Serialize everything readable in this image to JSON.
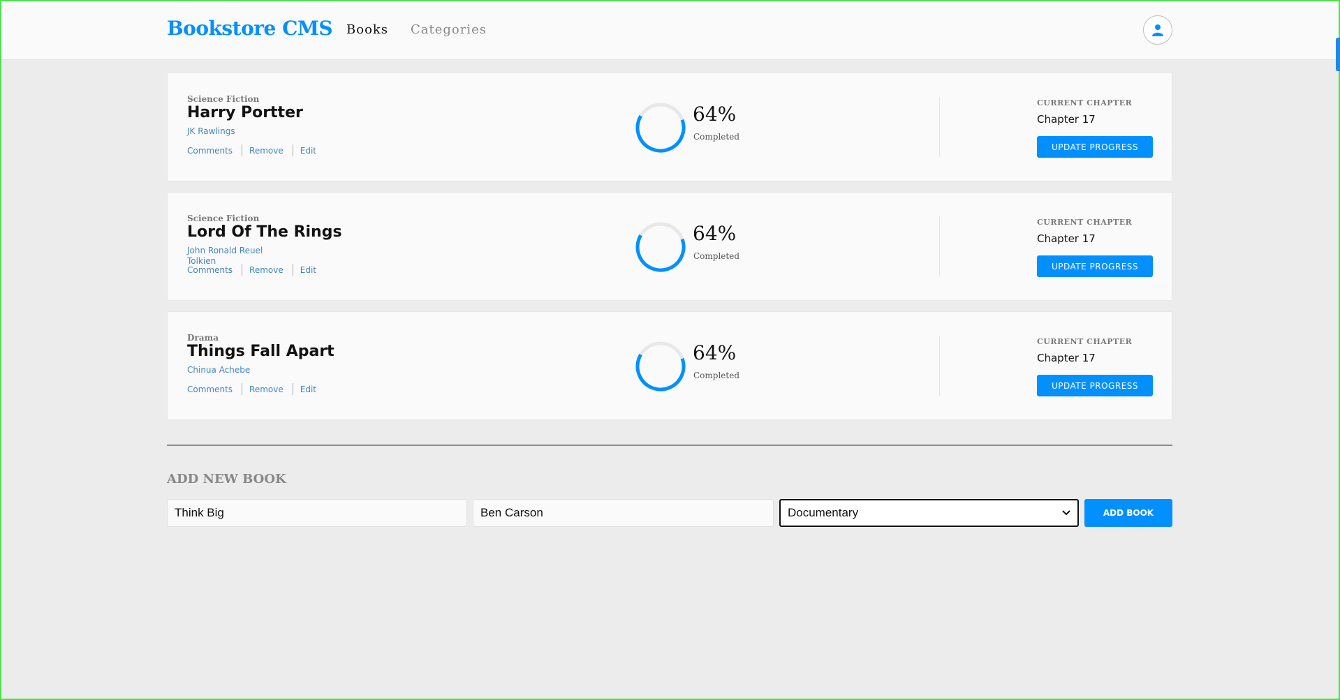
{
  "header": {
    "brand": "Bookstore CMS",
    "nav": [
      {
        "label": "Books"
      },
      {
        "label": "Categories"
      }
    ]
  },
  "books": [
    {
      "genre": "Science Fiction",
      "title": "Harry Portter",
      "author": "JK Rawlings",
      "actions": [
        "Comments",
        "Remove",
        "Edit"
      ],
      "progress_percent": 64,
      "percent_label": "64%",
      "completed_label": "Completed",
      "current_chapter_label": "CURRENT CHAPTER",
      "chapter": "Chapter 17",
      "update_label": "UPDATE PROGRESS"
    },
    {
      "genre": "Science Fiction",
      "title": "Lord Of The Rings",
      "author": "John Ronald Reuel Tolkien",
      "actions": [
        "Comments",
        "Remove",
        "Edit"
      ],
      "progress_percent": 64,
      "percent_label": "64%",
      "completed_label": "Completed",
      "current_chapter_label": "CURRENT CHAPTER",
      "chapter": "Chapter 17",
      "update_label": "UPDATE PROGRESS"
    },
    {
      "genre": "Drama",
      "title": "Things Fall Apart",
      "author": "Chinua Achebe",
      "actions": [
        "Comments",
        "Remove",
        "Edit"
      ],
      "progress_percent": 64,
      "percent_label": "64%",
      "completed_label": "Completed",
      "current_chapter_label": "CURRENT CHAPTER",
      "chapter": "Chapter 17",
      "update_label": "UPDATE PROGRESS"
    }
  ],
  "add_form": {
    "heading": "ADD NEW BOOK",
    "title_value": "Think Big",
    "author_value": "Ben Carson",
    "category_value": "Documentary",
    "submit_label": "ADD BOOK"
  },
  "colors": {
    "accent": "#0290ff",
    "link": "#4386bf",
    "ring_track": "#e8e8e8"
  }
}
